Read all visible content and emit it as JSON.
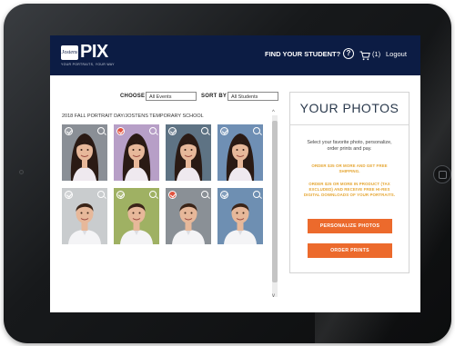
{
  "header": {
    "logo_badge": "Jostens",
    "logo_text": "PIX",
    "logo_tagline": "YOUR PORTRAITS, YOUR WAY",
    "find_student": "FIND YOUR STUDENT?",
    "help_icon": "?",
    "cart_icon": "cart-icon",
    "cart_count": "(1)",
    "logout": "Logout"
  },
  "filters": {
    "choose_label": "CHOOSE",
    "choose_value": "All Events",
    "sort_label": "SORT BY",
    "sort_value": "All Students"
  },
  "event_title": "2018 FALL PORTRAIT DAY/JOSTENS TEMPORARY SCHOOL",
  "photos": [
    {
      "subject": "girl",
      "bg": "#8a8f96",
      "selected": false
    },
    {
      "subject": "girl",
      "bg": "#b79fc7",
      "selected": true
    },
    {
      "subject": "girl",
      "bg": "#5e7384",
      "selected": false
    },
    {
      "subject": "girl",
      "bg": "#6f8fb4",
      "selected": false
    },
    {
      "subject": "boy",
      "bg": "#c9ccce",
      "selected": false
    },
    {
      "subject": "boy",
      "bg": "#9fb163",
      "selected": false
    },
    {
      "subject": "boy",
      "bg": "#8a9096",
      "selected": true
    },
    {
      "subject": "boy",
      "bg": "#6e8fb2",
      "selected": false
    }
  ],
  "panel": {
    "title": "YOUR PHOTOS",
    "description": "Select your favorite photo, personalize, order prints and pay.",
    "promo1": "ORDER $35 OR MORE AND GET FREE SHIPPING.",
    "promo2": "ORDER $25 OR MORE IN PRODUCT (TAX EXCLUDED) AND RECEIVE FREE HI-RES DIGITAL DOWNLOADS OF YOUR PORTRAITS.",
    "personalize_button": "PERSONALIZE PHOTOS",
    "order_button": "ORDER PRINTS"
  },
  "colors": {
    "navbar": "#0c1c44",
    "accent_orange": "#ec6a2c",
    "promo_gold": "#e5a633",
    "selected_red": "#e0523e"
  }
}
